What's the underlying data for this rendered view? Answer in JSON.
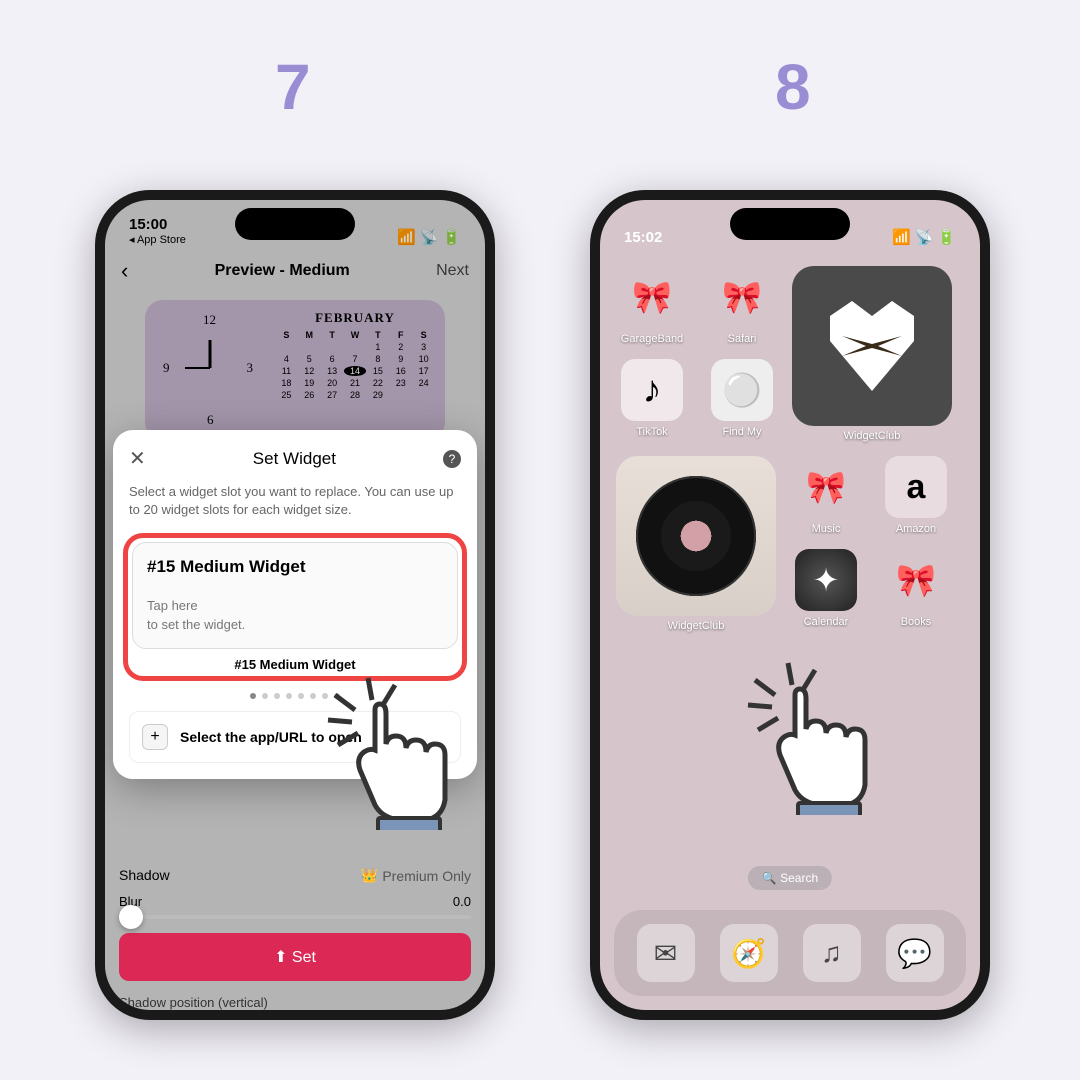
{
  "steps": {
    "seven": "7",
    "eight": "8"
  },
  "phone7": {
    "status": {
      "time": "15:00",
      "back": "◂ App Store"
    },
    "nav": {
      "back": "‹",
      "title": "Preview - Medium",
      "next": "Next"
    },
    "widget": {
      "month": "FEBRUARY",
      "days": [
        "S",
        "M",
        "T",
        "W",
        "T",
        "F",
        "S"
      ]
    },
    "modal": {
      "title": "Set Widget",
      "desc": "Select a widget slot you want to replace. You can use up to 20 widget slots for each widget size.",
      "slot_title": "#15 Medium Widget",
      "slot_hint1": "Tap here",
      "slot_hint2": "to set the widget.",
      "slot_label": "#15 Medium Widget",
      "select_app": "Select the app/URL to open"
    },
    "bottom": {
      "shadow": "Shadow",
      "premium": "Premium Only",
      "blur": "Blur",
      "blur_val": "0.0",
      "set": "Set",
      "shadow_pos": "Shadow position (vertical)"
    }
  },
  "phone8": {
    "status": {
      "time": "15:02"
    },
    "apps": {
      "garageband": "GarageBand",
      "safari": "Safari",
      "tiktok": "TikTok",
      "findmy": "Find My",
      "widgetclub": "WidgetClub",
      "music": "Music",
      "amazon": "Amazon",
      "calendar": "Calendar",
      "books": "Books"
    },
    "search": "🔍 Search"
  }
}
